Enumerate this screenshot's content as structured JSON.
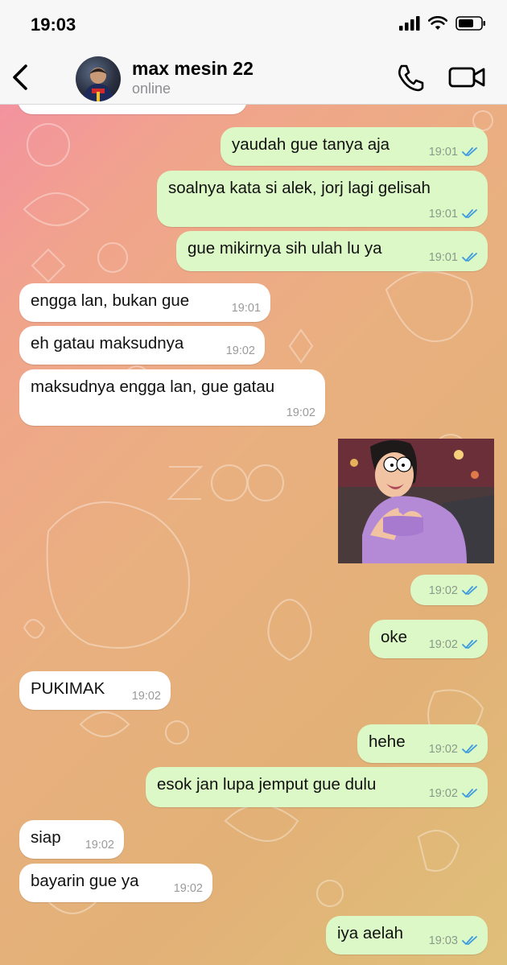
{
  "status_bar": {
    "time": "19:03"
  },
  "header": {
    "contact_name": "max mesin 22",
    "contact_status": "online"
  },
  "icons": {
    "back": "chevron-left-icon",
    "call": "phone-icon",
    "video": "video-camera-icon",
    "read": "double-check-icon"
  },
  "colors": {
    "outgoing_bubble": "#dcf8c6",
    "incoming_bubble": "#ffffff",
    "read_tick": "#3e9ae0"
  },
  "messages": [
    {
      "direction": "out",
      "text": "yaudah gue tanya aja",
      "time": "19:01",
      "read": true
    },
    {
      "direction": "out",
      "text": "soalnya kata si alek, jorj lagi gelisah",
      "time": "19:01",
      "read": true
    },
    {
      "direction": "out",
      "text": "gue mikirnya sih ulah lu ya",
      "time": "19:01",
      "read": true
    },
    {
      "direction": "in",
      "text": "engga lan, bukan gue",
      "time": "19:01"
    },
    {
      "direction": "in",
      "text": "eh gatau maksudnya",
      "time": "19:02"
    },
    {
      "direction": "in",
      "text": "maksudnya engga lan, gue gatau",
      "time": "19:02"
    },
    {
      "direction": "out",
      "type": "image",
      "text": "",
      "time": "19:02",
      "read": true
    },
    {
      "direction": "out",
      "text": "oke",
      "time": "19:02",
      "read": true
    },
    {
      "direction": "in",
      "text": "PUKIMAK",
      "time": "19:02"
    },
    {
      "direction": "out",
      "text": "hehe",
      "time": "19:02",
      "read": true
    },
    {
      "direction": "out",
      "text": "esok jan lupa jemput gue dulu",
      "time": "19:02",
      "read": true
    },
    {
      "direction": "in",
      "text": "siap",
      "time": "19:02"
    },
    {
      "direction": "in",
      "text": "bayarin gue ya",
      "time": "19:02"
    },
    {
      "direction": "out",
      "text": "iya aelah",
      "time": "19:03",
      "read": true
    }
  ]
}
